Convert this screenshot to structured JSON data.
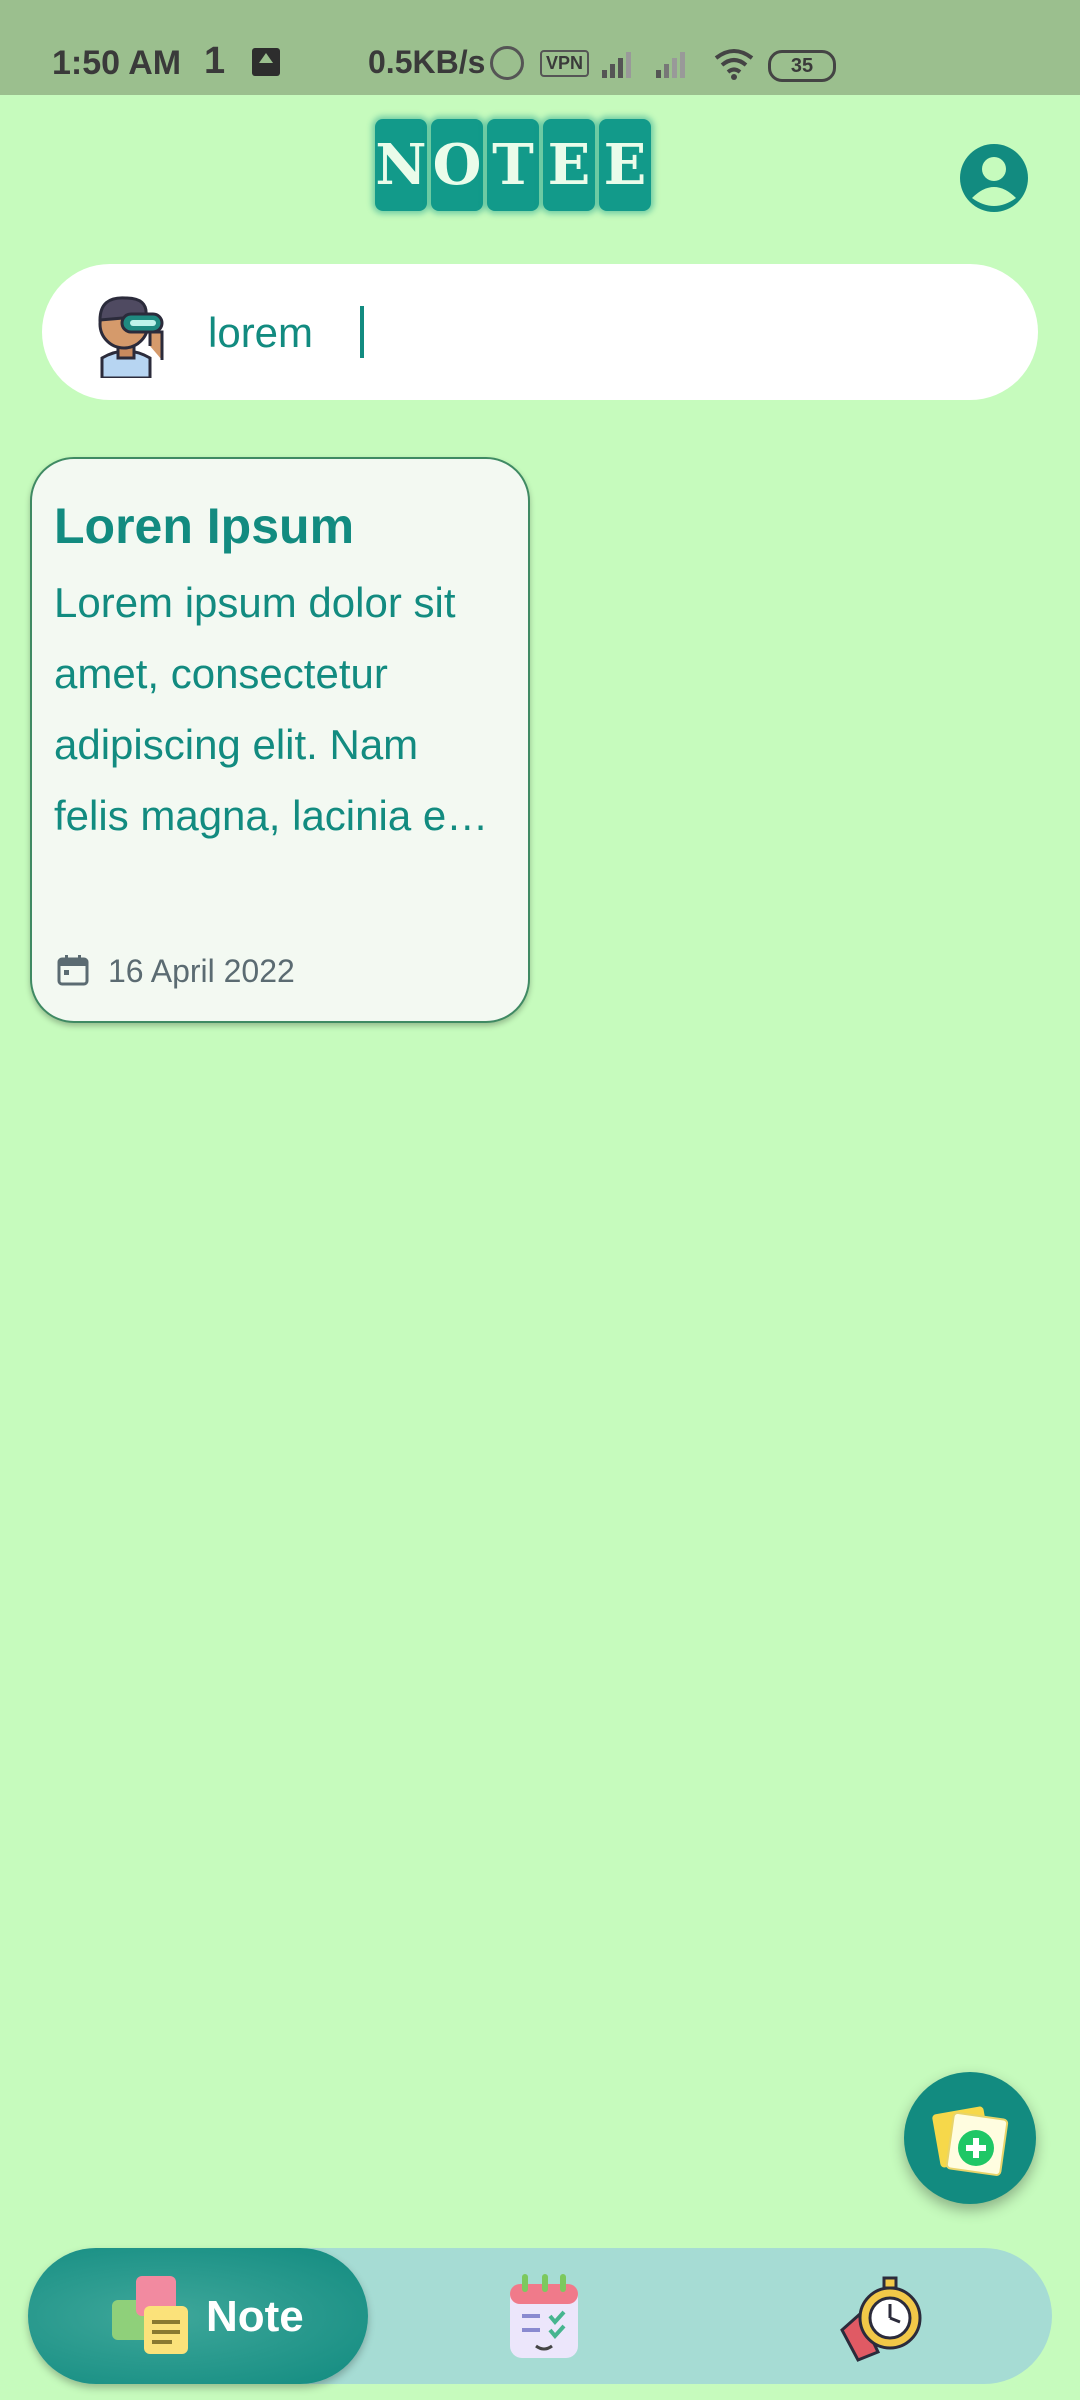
{
  "status_bar": {
    "time": "1:50 AM",
    "notification": "1",
    "network_speed": "0.5KB/s",
    "vpn_label": "VPN",
    "battery": "35"
  },
  "header": {
    "logo_letters": [
      "N",
      "O",
      "T",
      "E",
      "E"
    ],
    "profile_icon": "account-circle-icon"
  },
  "search": {
    "value": "lorem",
    "avatar_icon": "vr-user-avatar-icon"
  },
  "notes": [
    {
      "title": "Loren Ipsum",
      "body": "Lorem ipsum dolor sit amet, consectetur adipiscing elit. Nam felis magna, lacinia e…",
      "date": "16 April 2022"
    }
  ],
  "fab": {
    "icon": "add-note-icon"
  },
  "bottom_nav": {
    "active_label": "Note",
    "items": [
      "note-icon",
      "todo-calendar-icon",
      "timer-icon"
    ]
  },
  "colors": {
    "background": "#c6fbbd",
    "accent": "#128b80",
    "status_bar": "#9bbf8e",
    "nav_bar": "#a6dcd4"
  }
}
